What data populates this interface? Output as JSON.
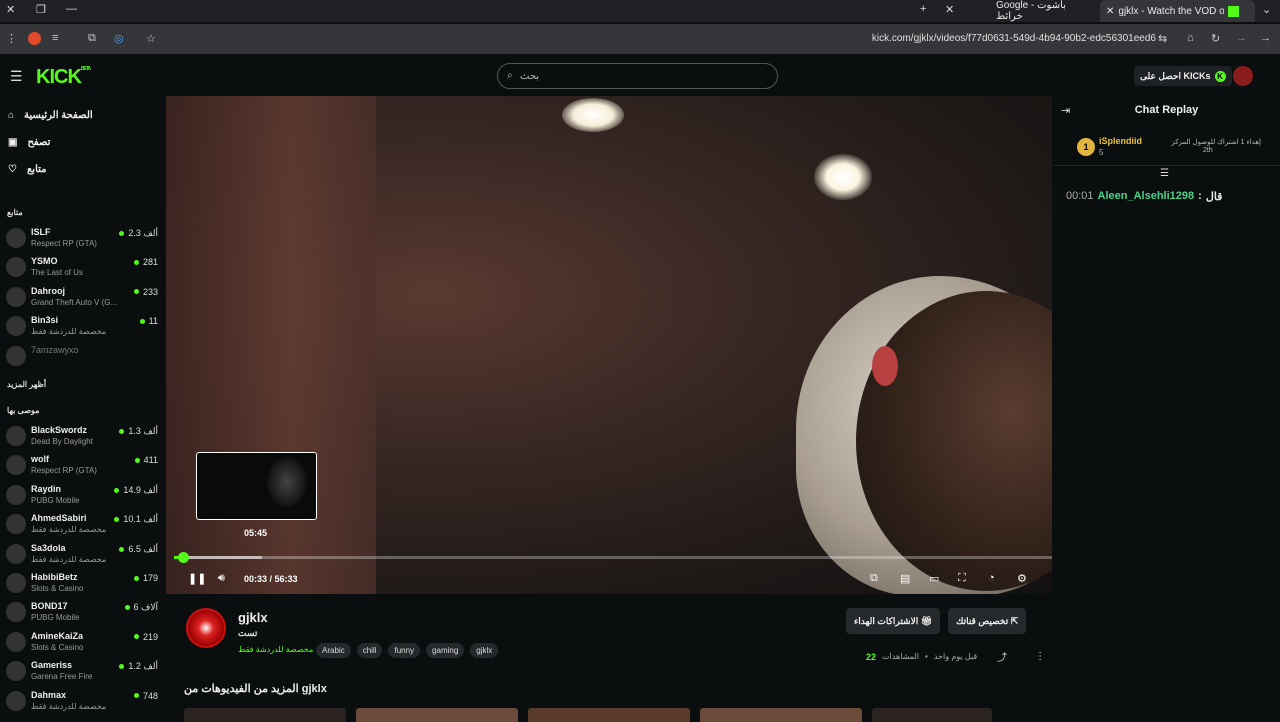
{
  "browser": {
    "tabs": [
      {
        "label": "Google باشوت - خرائط"
      },
      {
        "label": "gjklx - Watch the VOD on K"
      }
    ],
    "url": "kick.com/gjklx/videos/f77d0631-549d-4b94-90b2-edc56301eed6"
  },
  "header": {
    "logo": "KICK",
    "logo_badge": "BETA",
    "search_placeholder": "بحث",
    "kicks_button": "احصل على KICKs"
  },
  "sidebar": {
    "nav": [
      {
        "label": "الصفحة الرئيسية",
        "icon": "home-icon"
      },
      {
        "label": "تصفح",
        "icon": "browse-icon"
      },
      {
        "label": "متابع",
        "icon": "heart-icon"
      }
    ],
    "following_title": "متابع",
    "following": [
      {
        "name": "ISLF",
        "game": "Respect RP (GTA)",
        "viewers": "2.3 ألف",
        "live": true
      },
      {
        "name": "YSMO",
        "game": "The Last of Us",
        "viewers": "281",
        "live": true
      },
      {
        "name": "Dahrooj",
        "game": "Grand Theft Auto V (G...",
        "viewers": "233",
        "live": true
      },
      {
        "name": "Bin3si",
        "game": "مخصصة للدردشة فقط",
        "viewers": "11",
        "live": true
      },
      {
        "name": "7amzawyxo",
        "game": "",
        "viewers": "",
        "live": false
      }
    ],
    "show_more": "أظهر المزيد",
    "recommended_title": "موصى بها",
    "recommended": [
      {
        "name": "BlackSwordz",
        "game": "Dead By Daylight",
        "viewers": "1.3 ألف"
      },
      {
        "name": "wolf",
        "game": "Respect RP (GTA)",
        "viewers": "411"
      },
      {
        "name": "Raydin",
        "game": "PUBG Mobile",
        "viewers": "14.9 ألف"
      },
      {
        "name": "AhmedSabiri",
        "game": "مخصصة للدردشة فقط",
        "viewers": "10.1 ألف"
      },
      {
        "name": "Sa3dola",
        "game": "مخصصة للدردشة فقط",
        "viewers": "6.5 ألف"
      },
      {
        "name": "HabibiBetz",
        "game": "Slots & Casino",
        "viewers": "179"
      },
      {
        "name": "BOND17",
        "game": "PUBG Mobile",
        "viewers": "6 آلاف"
      },
      {
        "name": "AmineKaiZa",
        "game": "Slots & Casino",
        "viewers": "219"
      },
      {
        "name": "Gameriss",
        "game": "Garena Free Fire",
        "viewers": "1.2 ألف"
      },
      {
        "name": "Dahmax",
        "game": "مخصصة للدردشة فقط",
        "viewers": "748"
      }
    ]
  },
  "player": {
    "preview_time": "05:45",
    "current_time": "00:33",
    "duration": "56:33",
    "progress_fraction": 0.0097,
    "buffered_fraction": 0.1
  },
  "chat": {
    "title": "Chat Replay",
    "pinned": {
      "rank": "1",
      "username": "iSplendiid",
      "sub_count": "5",
      "gift_text": "إهداء 1 اشتراك للوصول المركز",
      "position": "2th"
    },
    "messages": [
      {
        "time": "00:01",
        "user": "Aleen_Alsehli1298",
        "text": "قال"
      }
    ]
  },
  "video_info": {
    "channel_name": "gjklx",
    "avatar_label": "GJKLX",
    "title": "تست",
    "category": "مخصصة للدردشة فقط",
    "tags": [
      "Arabic",
      "chill",
      "funny",
      "gaming",
      "gjklx"
    ],
    "clip_button": "تخصيص قناتك",
    "subs_button": "الاشتراكات الهداء",
    "views_count": "22",
    "views_label": "المشاهدات",
    "posted": "قبل يوم واحد",
    "more_videos": "المزيد من الفيديوهات من gjklx"
  },
  "colors": {
    "accent": "#53fc18",
    "background": "#0b0e0f"
  }
}
